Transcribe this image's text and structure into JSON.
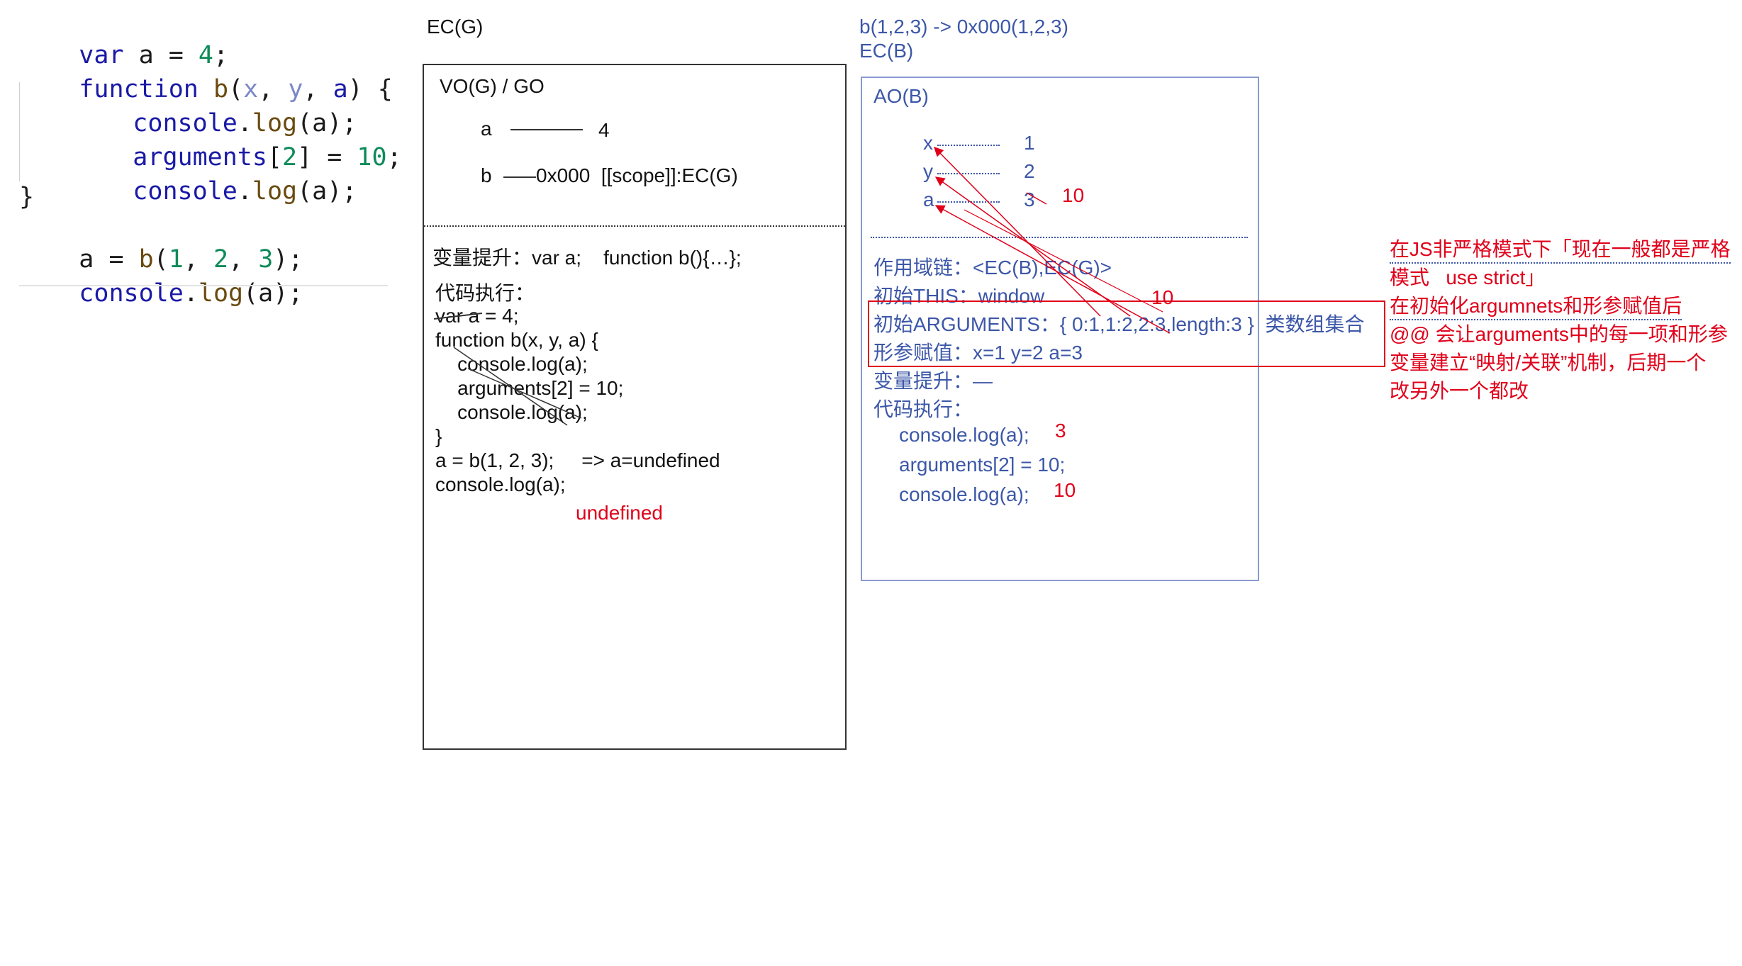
{
  "code": {
    "l1": {
      "kw": "var",
      "rest1": " a = ",
      "num": "4",
      "rest2": ";"
    },
    "l2": {
      "kw": "function",
      "sp": " ",
      "fname": "b",
      "p1": "(",
      "x": "x",
      ",1": ", ",
      "y": "y",
      ",2": ", ",
      "a": "a",
      "p2": ") {"
    },
    "l3": {
      "obj": "console",
      "dot": ".",
      "fn": "log",
      "rest": "(a);"
    },
    "l4": {
      "kw": "arguments",
      "rest1": "[",
      "num": "2",
      "rest2": "] = ",
      "num2": "10",
      "rest3": ";"
    },
    "l5": {
      "obj": "console",
      "dot": ".",
      "fn": "log",
      "rest": "(a);"
    },
    "l6": "}",
    "l7": {
      "pre": "a = ",
      "fn": "b",
      "p1": "(",
      "n1": "1",
      ",1": ", ",
      "n2": "2",
      ",2": ", ",
      "n3": "3",
      "p2": ");"
    },
    "l8": {
      "obj": "console",
      "dot": ".",
      "fn": "log",
      "rest": "(a);"
    }
  },
  "global": {
    "ec_title": "EC(G)",
    "vo_title": "VO(G) / GO",
    "var_a_name": "a",
    "var_a_value": "4",
    "var_b_name": "b",
    "var_b_value": "0x000  [[scope]]:EC(G)",
    "hoisting": "变量提升：var a;    function b(){…};",
    "exec_title": "代码执行：",
    "exec_lines": [
      "var a = 4;",
      "function b(x, y, a) {",
      "    console.log(a);",
      "    arguments[2] = 10;",
      "    console.log(a);",
      "}",
      "a = b(1, 2, 3);     => a=undefined",
      "console.log(a);"
    ],
    "undefined_label": "undefined"
  },
  "func": {
    "call_line": "b(1,2,3) -> 0x000(1,2,3)",
    "ec_title": "EC(B)",
    "ao_title": "AO(B)",
    "params": [
      {
        "name": "x",
        "value": "1"
      },
      {
        "name": "y",
        "value": "2"
      },
      {
        "name": "a",
        "value": "3"
      }
    ],
    "a_changed_value": "10",
    "scope_chain": "作用域链：<EC(B),EC(G)>",
    "this_line": "初始THIS：window",
    "this_note": "10",
    "arguments_line": "初始ARGUMENTS：{ 0:1,1:2,2:3,length:3 }  类数组集合",
    "params_assign": "形参赋值：x=1 y=2 a=3",
    "hoisting": "变量提升：—",
    "exec_title": "代码执行：",
    "exec_lines": [
      "console.log(a);",
      "arguments[2] = 10;",
      "console.log(a);"
    ],
    "log1_value": "3",
    "log2_value": "10"
  },
  "note": {
    "lines": [
      "在JS非严格模式下「现在一般都是严格",
      "模式   use strict」",
      "在初始化argumnets和形参赋值后",
      "@@ 会让arguments中的每一项和形参",
      "变量建立“映射/关联”机制，后期一个",
      "改另外一个都改"
    ]
  },
  "colors": {
    "blue": "#3c57a8",
    "red": "#e0001a",
    "box_border": "#8a9ad0"
  }
}
